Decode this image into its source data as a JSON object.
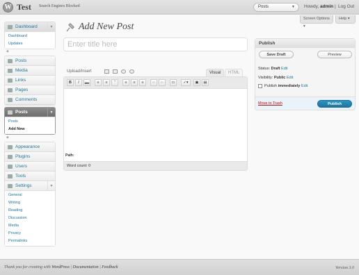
{
  "header": {
    "site_name": "Test",
    "site_visibility": "Search Engines Blocked",
    "favorite_select": "Posts",
    "howdy_prefix": "Howdy,",
    "user": "admin",
    "logout": "Log Out"
  },
  "tabs": {
    "screen_options": "Screen Options ▾",
    "help": "Help ▾"
  },
  "sidebar": {
    "dashboard": {
      "label": "Dashboard",
      "items": [
        "Dashboard",
        "Updates"
      ]
    },
    "group1": [
      "Posts",
      "Media",
      "Links",
      "Pages",
      "Comments"
    ],
    "posts_active": {
      "label": "Posts",
      "items": [
        "Posts",
        "Add New"
      ]
    },
    "group2": [
      "Appearance",
      "Plugins",
      "Users",
      "Tools"
    ],
    "settings": {
      "label": "Settings",
      "items": [
        "General",
        "Writing",
        "Reading",
        "Discussion",
        "Media",
        "Privacy",
        "Permalinks"
      ]
    }
  },
  "page": {
    "title": "Add New Post",
    "title_placeholder": "Enter title here"
  },
  "editor": {
    "upload_label": "Upload/Insert",
    "tab_visual": "Visual",
    "tab_html": "HTML",
    "path_label": "Path:",
    "word_count": "Word count: 0"
  },
  "publish": {
    "heading": "Publish",
    "save_draft": "Save Draft",
    "preview": "Preview",
    "status_label": "Status:",
    "status_value": "Draft",
    "visibility_label": "Visibility:",
    "visibility_value": "Public",
    "publish_label": "Publish",
    "publish_value": "immediately",
    "edit": "Edit",
    "move_to_trash": "Move to Trash",
    "publish_button": "Publish"
  },
  "footer": {
    "thanks": "Thank you for creating with",
    "wordpress": "WordPress",
    "documentation": "Documentation",
    "feedback": "Feedback",
    "version": "Version 3.0"
  },
  "colors": {
    "link": "#21759b",
    "publish_button": "#21759b",
    "trash": "#bc0b0b",
    "active_menu": "#6d6d6d"
  }
}
